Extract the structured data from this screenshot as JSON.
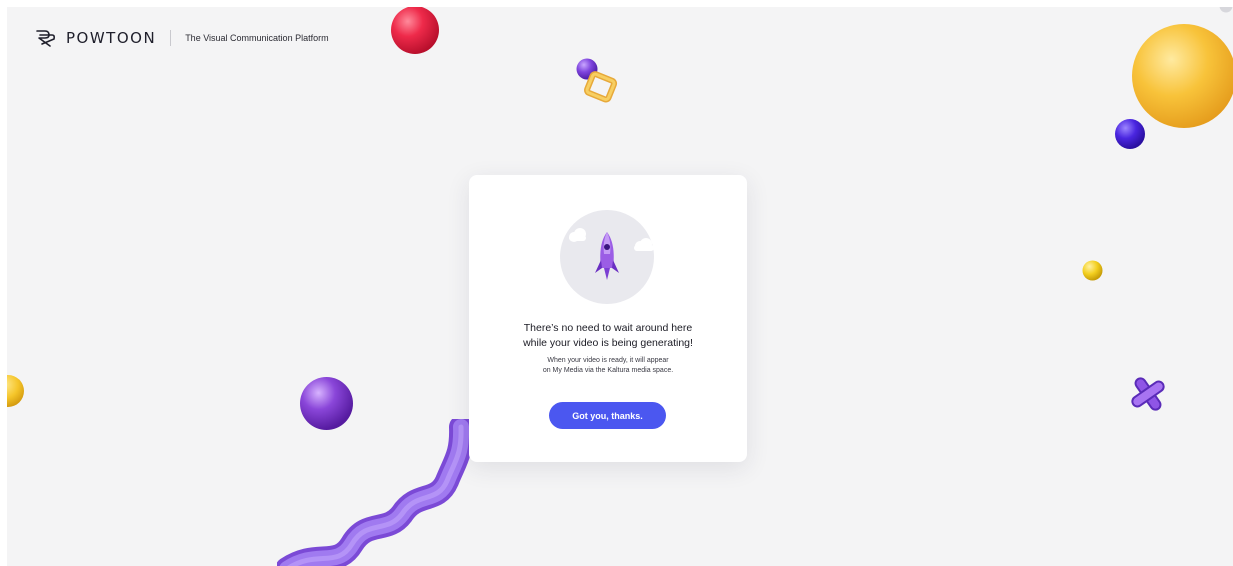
{
  "header": {
    "brand_name": "POWTOON",
    "tagline": "The Visual Communication Platform",
    "logo_icon": "powtoon-logo-icon"
  },
  "dialog": {
    "title_line_1": "There’s no need to wait around here",
    "title_line_2": "while your video is being generating!",
    "body_line_1": "When your video is ready, it will appear",
    "body_line_2": "on My Media via the Kaltura media space.",
    "confirm_label": "Got you, thanks.",
    "illustration_icon": "rocket-icon"
  },
  "colors": {
    "background": "#f4f4f5",
    "primary_button": "#4b57f0",
    "accent_purple": "#8a4fd8",
    "accent_yellow": "#f6c63a",
    "accent_red": "#e8203f",
    "accent_blue": "#4422d6"
  }
}
